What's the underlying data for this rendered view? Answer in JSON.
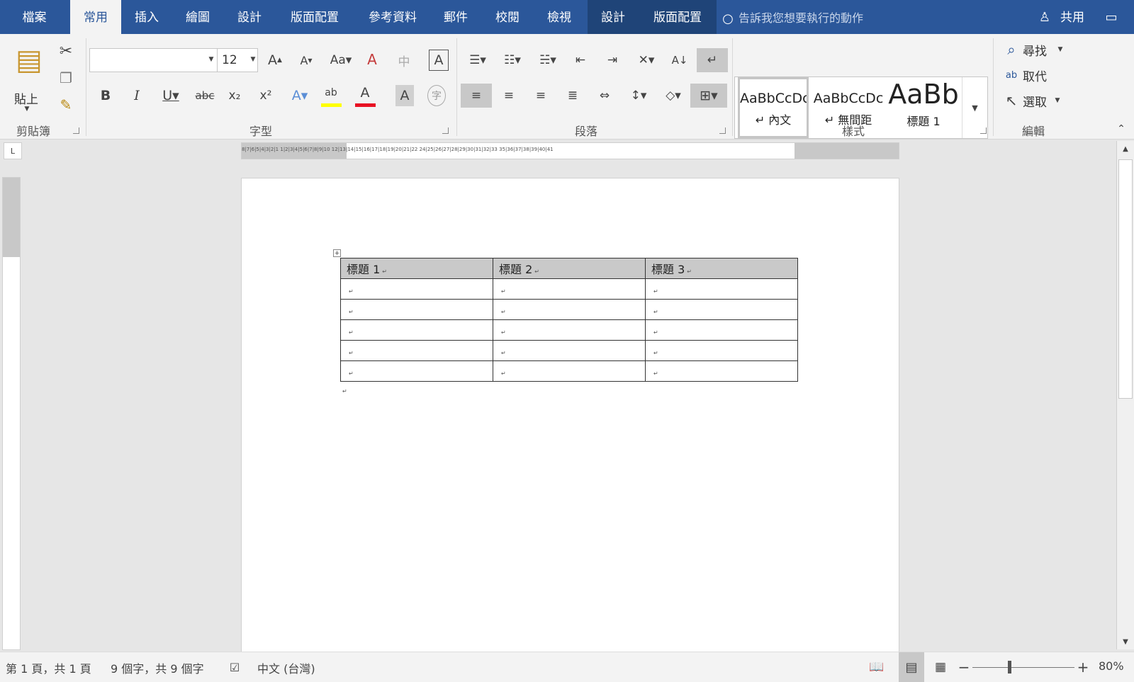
{
  "tabs": [
    {
      "label": "檔案"
    },
    {
      "label": "常用"
    },
    {
      "label": "插入"
    },
    {
      "label": "繪圖"
    },
    {
      "label": "設計"
    },
    {
      "label": "版面配置"
    },
    {
      "label": "參考資料"
    },
    {
      "label": "郵件"
    },
    {
      "label": "校閱"
    },
    {
      "label": "檢視"
    },
    {
      "label": "設計"
    },
    {
      "label": "版面配置"
    }
  ],
  "tell_me": "告訴我您想要執行的動作",
  "share": "共用",
  "clipboard": {
    "group": "剪貼簿",
    "paste": "貼上"
  },
  "font": {
    "group": "字型",
    "name": "",
    "size": "12"
  },
  "paragraph": {
    "group": "段落"
  },
  "styles": {
    "group": "樣式",
    "items": [
      {
        "preview": "AaBbCcDc",
        "name": "內文"
      },
      {
        "preview": "AaBbCcDc",
        "name": "無間距"
      },
      {
        "preview": "AaBb",
        "name": "標題 1"
      }
    ]
  },
  "editing": {
    "group": "編輯",
    "find": "尋找",
    "replace": "取代",
    "select": "選取"
  },
  "ruler_h": "8|7|6|5|4|3|2|1 1|2|3|4|5|6|7|8|9|10 12|13|14|15|16|17|18|19|20|21|22 24|25|26|27|28|29|30|31|32|33 35|36|37|38|39|40|41",
  "table": {
    "headers": [
      "標題 1",
      "標題 2",
      "標題 3"
    ],
    "rows": 5
  },
  "status": {
    "page": "第 1 頁，共 1 頁",
    "words": "9 個字，共 9 個字",
    "lang": "中文 (台灣)",
    "zoom": "80%"
  },
  "colors": {
    "tabbar": "#2b579a",
    "highlight": "#ffff00",
    "font_color": "#ff0000"
  }
}
